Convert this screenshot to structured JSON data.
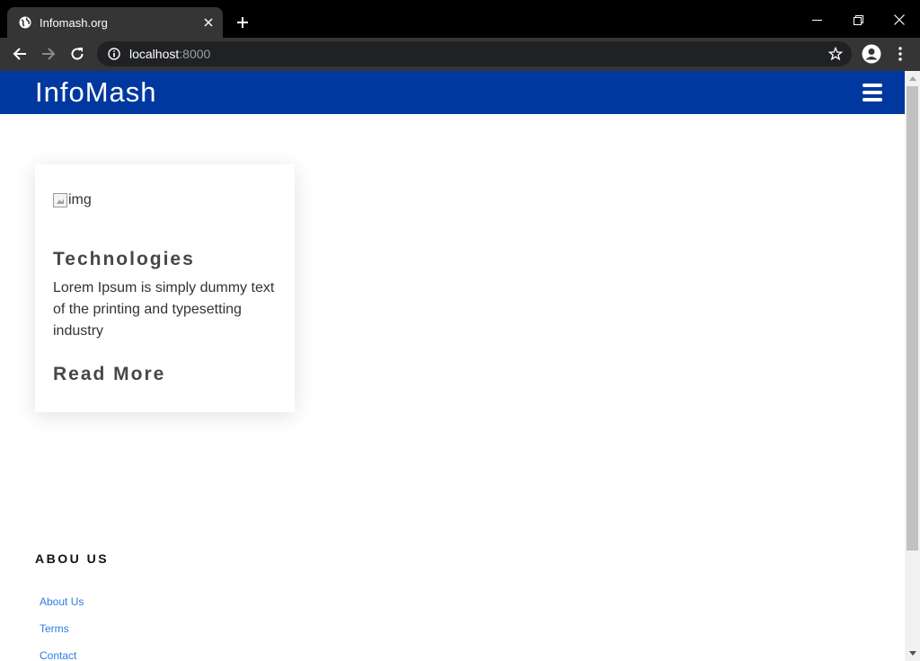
{
  "browser": {
    "tab_title": "Infomash.org",
    "url_host": "localhost",
    "url_port": ":8000"
  },
  "site": {
    "brand": "InfoMash"
  },
  "card": {
    "image_alt": "img",
    "title": "Technologies",
    "text": "Lorem Ipsum is simply dummy text of the printing and typesetting industry",
    "link": "Read More"
  },
  "footer": {
    "heading": "ABOU US",
    "links": [
      "About Us",
      "Terms",
      "Contact"
    ]
  },
  "colors": {
    "header_bg": "#0038a0",
    "link": "#2b7de1",
    "chrome_dark": "#000000",
    "toolbar": "#353535"
  }
}
